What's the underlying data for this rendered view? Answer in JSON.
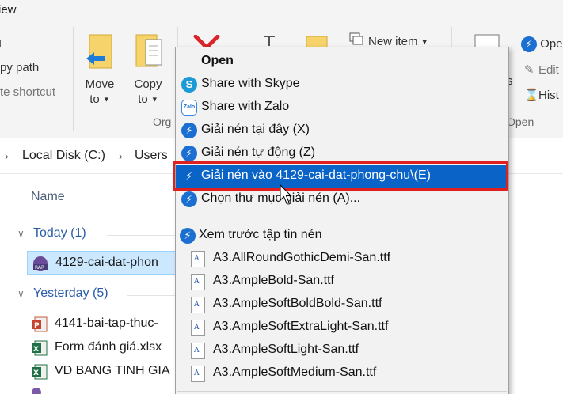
{
  "ribbon": {
    "tab_view": "iew",
    "copy_path": "py path",
    "paste_shortcut": "te shortcut",
    "move_to": "Move",
    "move_to_2": "to",
    "copy_to": "Copy",
    "copy_to_2": "to",
    "organize_label": "Org",
    "new_item": "New item",
    "open_label": "Ope",
    "edit_label": "Edit",
    "history_label": "Hist",
    "open_group_label": "Open",
    "cut_s": "s"
  },
  "address": {
    "drive": "Local Disk (C:)",
    "folder": "Users"
  },
  "list": {
    "column_name": "Name",
    "groups": [
      {
        "label": "Today (1)"
      },
      {
        "label": "Yesterday (5)"
      }
    ],
    "files": [
      {
        "name": "4129-cai-dat-phon",
        "type": "rar"
      },
      {
        "name": "4141-bai-tap-thuc-",
        "type": "pptx"
      },
      {
        "name": "Form đánh giá.xlsx",
        "type": "xlsx"
      },
      {
        "name": "VD BANG TINH GIA",
        "type": "xlsx"
      }
    ]
  },
  "menu": {
    "items": [
      {
        "label": "Open",
        "icon": "none"
      },
      {
        "label": "Share with Skype",
        "icon": "skype-icon"
      },
      {
        "label": "Share with Zalo",
        "icon": "zalo-icon"
      },
      {
        "label": "Giải nén tại đây (X)",
        "icon": "extract-icon"
      },
      {
        "label": "Giải nén tự động (Z)",
        "icon": "extract-icon"
      },
      {
        "label": "Giải nén vào 4129-cai-dat-phong-chu\\(E)",
        "icon": "extract-icon"
      },
      {
        "label": "Chọn thư mục giải nén (A)...",
        "icon": "extract-icon"
      },
      {
        "label": "Xem trước tập tin nén",
        "icon": "extract-icon"
      },
      {
        "label": "A3.AllRoundGothicDemi-San.ttf",
        "icon": "ttf-icon"
      },
      {
        "label": "A3.AmpleBold-San.ttf",
        "icon": "ttf-icon"
      },
      {
        "label": "A3.AmpleSoftBoldBold-San.ttf",
        "icon": "ttf-icon"
      },
      {
        "label": "A3.AmpleSoftExtraLight-San.ttf",
        "icon": "ttf-icon"
      },
      {
        "label": "A3.AmpleSoftLight-San.ttf",
        "icon": "ttf-icon"
      },
      {
        "label": "A3.AmpleSoftMedium-San.ttf",
        "icon": "ttf-icon"
      }
    ]
  },
  "colors": {
    "highlight": "#0a64c8",
    "red_box": "#e0201e",
    "group_header": "#2a5ba8",
    "selection": "#cce8ff"
  }
}
